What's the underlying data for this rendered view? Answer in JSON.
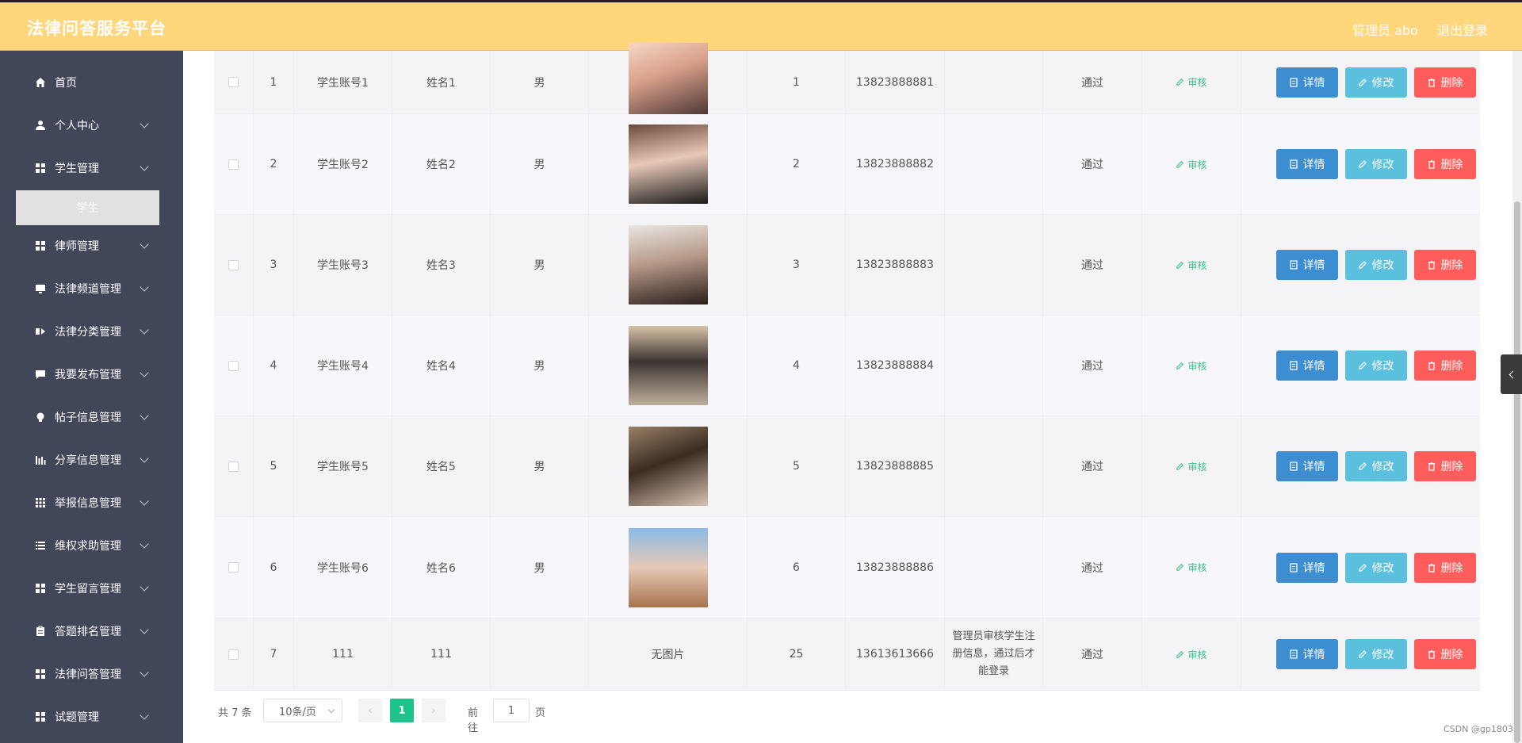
{
  "header": {
    "title": "法律问答服务平台",
    "user": "管理员 abo",
    "logout": "退出登录"
  },
  "sidebar": {
    "items": [
      {
        "label": "首页",
        "icon": "home-icon",
        "expandable": false
      },
      {
        "label": "个人中心",
        "icon": "user-icon",
        "expandable": true
      },
      {
        "label": "学生管理",
        "icon": "grid-icon",
        "expandable": true
      },
      {
        "label": "律师管理",
        "icon": "grid-icon",
        "expandable": true
      },
      {
        "label": "法律频道管理",
        "icon": "monitor-icon",
        "expandable": true
      },
      {
        "label": "法律分类管理",
        "icon": "category-icon",
        "expandable": true
      },
      {
        "label": "我要发布管理",
        "icon": "message-icon",
        "expandable": true
      },
      {
        "label": "帖子信息管理",
        "icon": "bulb-icon",
        "expandable": true
      },
      {
        "label": "分享信息管理",
        "icon": "bar-chart-icon",
        "expandable": true
      },
      {
        "label": "举报信息管理",
        "icon": "apps-icon",
        "expandable": true
      },
      {
        "label": "维权求助管理",
        "icon": "list-icon",
        "expandable": true
      },
      {
        "label": "学生留言管理",
        "icon": "grid-icon",
        "expandable": true
      },
      {
        "label": "答题排名管理",
        "icon": "clipboard-icon",
        "expandable": true
      },
      {
        "label": "法律问答管理",
        "icon": "grid-icon",
        "expandable": true
      },
      {
        "label": "试题管理",
        "icon": "grid-icon",
        "expandable": true
      }
    ],
    "active_sub": "学生"
  },
  "table": {
    "rows": [
      {
        "index": "1",
        "account": "学生账号1",
        "name": "姓名1",
        "gender": "男",
        "photo": "photo-1",
        "age": "1",
        "phone": "13823888881",
        "memo": "",
        "status": "通过"
      },
      {
        "index": "2",
        "account": "学生账号2",
        "name": "姓名2",
        "gender": "男",
        "photo": "photo-2",
        "age": "2",
        "phone": "13823888882",
        "memo": "",
        "status": "通过"
      },
      {
        "index": "3",
        "account": "学生账号3",
        "name": "姓名3",
        "gender": "男",
        "photo": "photo-3",
        "age": "3",
        "phone": "13823888883",
        "memo": "",
        "status": "通过"
      },
      {
        "index": "4",
        "account": "学生账号4",
        "name": "姓名4",
        "gender": "男",
        "photo": "photo-4",
        "age": "4",
        "phone": "13823888884",
        "memo": "",
        "status": "通过"
      },
      {
        "index": "5",
        "account": "学生账号5",
        "name": "姓名5",
        "gender": "男",
        "photo": "photo-5",
        "age": "5",
        "phone": "13823888885",
        "memo": "",
        "status": "通过"
      },
      {
        "index": "6",
        "account": "学生账号6",
        "name": "姓名6",
        "gender": "男",
        "photo": "photo-6",
        "age": "6",
        "phone": "13823888886",
        "memo": "",
        "status": "通过"
      },
      {
        "index": "7",
        "account": "111",
        "name": "111",
        "gender": "",
        "photo": "",
        "photo_text": "无图片",
        "age": "25",
        "phone": "13613613666",
        "memo": "管理员审核学生注册信息，通过后才能登录",
        "status": "通过"
      }
    ],
    "audit_label": "审核",
    "detail_label": "详情",
    "edit_label": "修改",
    "delete_label": "删除"
  },
  "pagination": {
    "total": "共 7 条",
    "page_size": "10条/页",
    "current_page": "1",
    "goto_prefix": "前往",
    "goto_value": "1",
    "goto_suffix": "页"
  },
  "watermark": "CSDN @gp1803",
  "colors": {
    "header_bg": "#ffd67c",
    "sidebar_bg": "#414659",
    "detail_btn": "#3d8dd1",
    "edit_btn": "#5bc0de",
    "delete_btn": "#ff5c5c",
    "audit_text": "#3fbf8a",
    "current_page": "#1ec28b"
  }
}
